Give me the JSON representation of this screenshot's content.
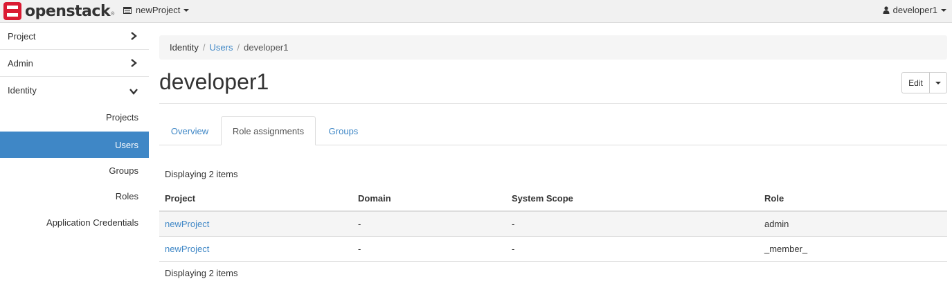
{
  "navbar": {
    "brand": "openstack",
    "brand_reg": "®",
    "project_switcher": "newProject",
    "user_menu": "developer1",
    "brand_color": "#da1a32"
  },
  "sidebar": {
    "groups": [
      {
        "label": "Project"
      },
      {
        "label": "Admin"
      },
      {
        "label": "Identity"
      }
    ],
    "items": [
      {
        "label": "Projects"
      },
      {
        "label": "Users"
      },
      {
        "label": "Groups"
      },
      {
        "label": "Roles"
      },
      {
        "label": "Application Credentials"
      }
    ],
    "active_color": "#3f87c6"
  },
  "breadcrumb": {
    "root": "Identity",
    "link": "Users",
    "current": "developer1",
    "sep": "/"
  },
  "page": {
    "title": "developer1",
    "edit_label": "Edit"
  },
  "tabs": [
    {
      "label": "Overview"
    },
    {
      "label": "Role assignments"
    },
    {
      "label": "Groups"
    }
  ],
  "table": {
    "count_top": "Displaying 2 items",
    "count_bottom": "Displaying 2 items",
    "headers": {
      "project": "Project",
      "domain": "Domain",
      "scope": "System Scope",
      "role": "Role"
    },
    "rows": [
      {
        "project": "newProject",
        "domain": "-",
        "scope": "-",
        "role": "admin"
      },
      {
        "project": "newProject",
        "domain": "-",
        "scope": "-",
        "role": "_member_"
      }
    ]
  }
}
